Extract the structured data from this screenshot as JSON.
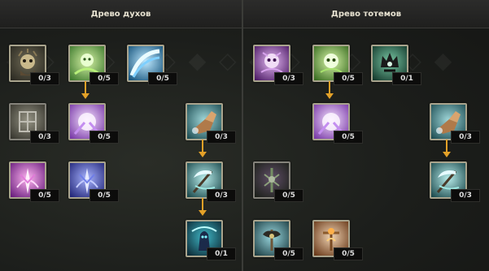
{
  "headers": {
    "left": "Древо духов",
    "right": "Древо тотемов"
  },
  "colors": {
    "arrow": "#e3a128",
    "frame": "#a9a48d",
    "header_text": "#e8e3d2"
  },
  "spirit_tree": [
    {
      "icon": "spirit-mask-icon",
      "points": "0/3"
    },
    {
      "icon": "green-spirit-icon",
      "points": "0/5"
    },
    {
      "icon": "blue-wave-icon",
      "points": "0/5"
    },
    {
      "icon": "rune-shield-icon",
      "points": "0/3"
    },
    {
      "icon": "violet-glow-icon",
      "points": "0/5"
    },
    {
      "icon": "fist-strike-icon",
      "points": "0/3"
    },
    {
      "icon": "pink-sprite-icon",
      "points": "0/5"
    },
    {
      "icon": "blue-sprite-icon",
      "points": "0/5"
    },
    {
      "icon": "scythe-icon",
      "points": "0/3"
    },
    {
      "icon": "dark-spirit-icon",
      "points": "0/1"
    }
  ],
  "totem_tree": [
    {
      "icon": "purple-skull-icon",
      "points": "0/3"
    },
    {
      "icon": "green-skull-icon",
      "points": "0/5"
    },
    {
      "icon": "crown-totem-icon",
      "points": "0/1"
    },
    {
      "icon": "violet-glow-icon",
      "points": "0/5"
    },
    {
      "icon": "fist-strike-icon",
      "points": "0/3"
    },
    {
      "icon": "swamp-totem-icon",
      "points": "0/5"
    },
    {
      "icon": "scythe-icon",
      "points": "0/3"
    },
    {
      "icon": "horned-totem-icon",
      "points": "0/5"
    },
    {
      "icon": "fire-totem-icon",
      "points": "0/5"
    }
  ]
}
